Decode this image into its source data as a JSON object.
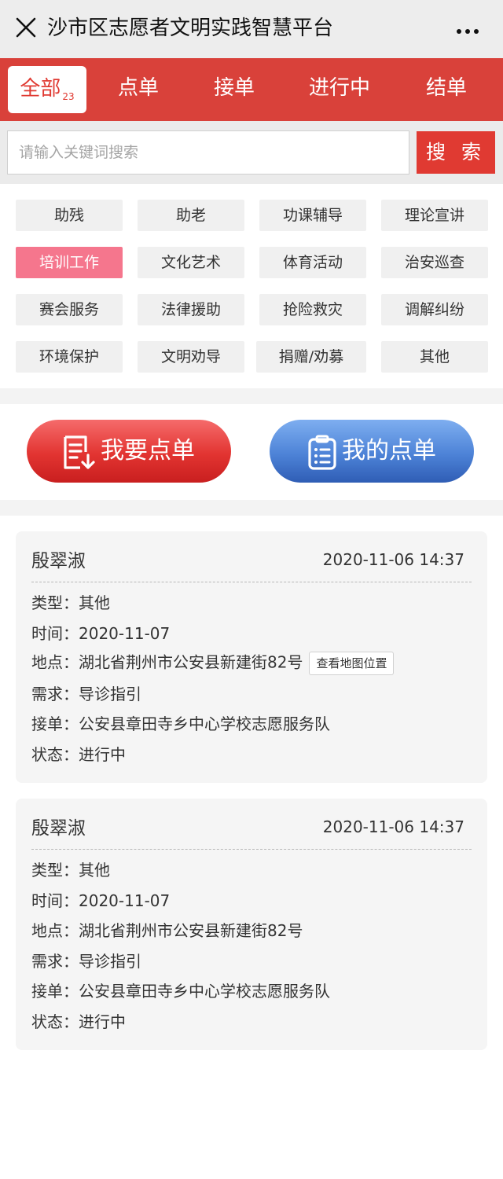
{
  "titlebar": {
    "title": "沙市区志愿者文明实践智慧平台",
    "close_icon": "close-icon",
    "more_icon": "more-icon"
  },
  "tabs": [
    {
      "label": "全部",
      "count": "23",
      "active": true
    },
    {
      "label": "点单"
    },
    {
      "label": "接单"
    },
    {
      "label": "进行中"
    },
    {
      "label": "结单"
    }
  ],
  "search": {
    "placeholder": "请输入关键词搜索",
    "button_label": "搜 索"
  },
  "categories": [
    "助残",
    "助老",
    "功课辅导",
    "理论宣讲",
    "培训工作",
    "文化艺术",
    "体育活动",
    "治安巡查",
    "赛会服务",
    "法律援助",
    "抢险救灾",
    "调解纠纷",
    "环境保护",
    "文明劝导",
    "捐赠/劝募",
    "其他"
  ],
  "selected_category": "培训工作",
  "actions": {
    "order": {
      "label": "我要点单",
      "icon": "order-form-icon"
    },
    "mine": {
      "label": "我的点单",
      "icon": "clipboard-list-icon"
    }
  },
  "colors": {
    "accent": "#e03a32",
    "tab_bar": "#d9413a",
    "category_active": "#f5768d",
    "blue_button": "#4d83d7"
  },
  "labels": {
    "type": "类型：",
    "time": "时间：",
    "location": "地点：",
    "demand": "需求：",
    "taker": "接单：",
    "status": "状态："
  },
  "orders": [
    {
      "name": "殷翠淑",
      "datetime": "2020-11-06 14:37",
      "type": "其他",
      "time": "2020-11-07",
      "location": "湖北省荆州市公安县新建街82号",
      "map_button": "查看地图位置",
      "demand": "导诊指引",
      "taker": "公安县章田寺乡中心学校志愿服务队",
      "status": "进行中"
    },
    {
      "name": "殷翠淑",
      "datetime": "2020-11-06 14:37",
      "type": "其他",
      "time": "2020-11-07",
      "location": "湖北省荆州市公安县新建街82号",
      "demand": "导诊指引",
      "taker": "公安县章田寺乡中心学校志愿服务队",
      "status": "进行中"
    }
  ]
}
